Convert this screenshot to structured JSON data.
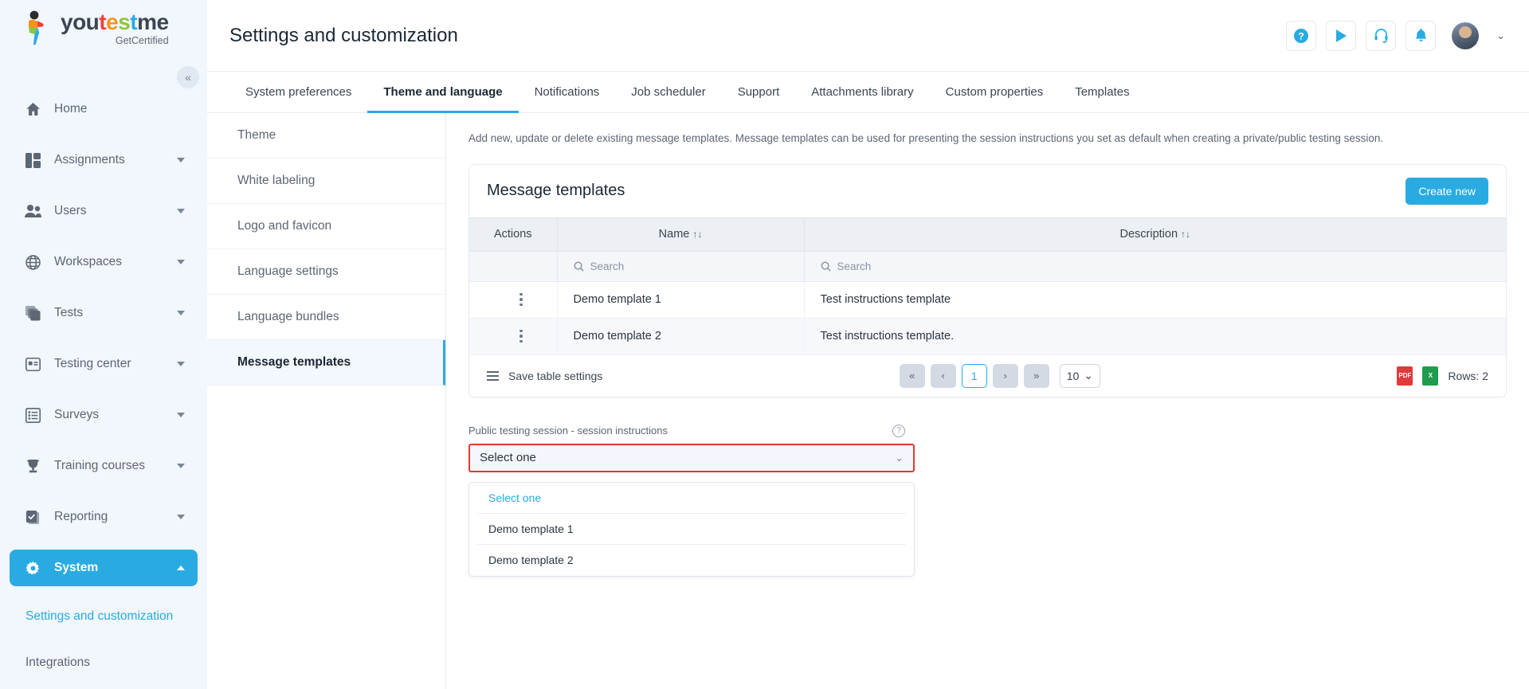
{
  "brand": {
    "name_parts": [
      "you",
      "t",
      "e",
      "s",
      "t",
      "me"
    ],
    "tagline": "GetCertified",
    "collapse_icon": "«"
  },
  "sidebar": {
    "items": [
      {
        "label": "Home",
        "icon": "home-icon",
        "has_caret": false,
        "active": false
      },
      {
        "label": "Assignments",
        "icon": "assignments-icon",
        "has_caret": true,
        "active": false
      },
      {
        "label": "Users",
        "icon": "users-icon",
        "has_caret": true,
        "active": false
      },
      {
        "label": "Workspaces",
        "icon": "globe-icon",
        "has_caret": true,
        "active": false
      },
      {
        "label": "Tests",
        "icon": "tests-icon",
        "has_caret": true,
        "active": false
      },
      {
        "label": "Testing center",
        "icon": "testing-center-icon",
        "has_caret": true,
        "active": false
      },
      {
        "label": "Surveys",
        "icon": "surveys-icon",
        "has_caret": true,
        "active": false
      },
      {
        "label": "Training courses",
        "icon": "trophy-icon",
        "has_caret": true,
        "active": false
      },
      {
        "label": "Reporting",
        "icon": "reporting-icon",
        "has_caret": true,
        "active": false
      },
      {
        "label": "System",
        "icon": "gear-icon",
        "has_caret": true,
        "active": true
      }
    ],
    "sub_items": [
      {
        "label": "Settings and customization",
        "linked": true
      },
      {
        "label": "Integrations",
        "linked": false
      }
    ]
  },
  "header": {
    "title": "Settings and customization",
    "actions": [
      {
        "name": "help-icon",
        "glyph": "?"
      },
      {
        "name": "play-icon",
        "glyph": "▶"
      },
      {
        "name": "headset-support-icon",
        "glyph": "headset"
      },
      {
        "name": "bell-notifications-icon",
        "glyph": "bell"
      }
    ],
    "avatar_caret": "⌄"
  },
  "tabs": [
    {
      "label": "System preferences",
      "active": false
    },
    {
      "label": "Theme and language",
      "active": true
    },
    {
      "label": "Notifications",
      "active": false
    },
    {
      "label": "Job scheduler",
      "active": false
    },
    {
      "label": "Support",
      "active": false
    },
    {
      "label": "Attachments library",
      "active": false
    },
    {
      "label": "Custom properties",
      "active": false
    },
    {
      "label": "Templates",
      "active": false
    }
  ],
  "subnav": [
    {
      "label": "Theme",
      "active": false
    },
    {
      "label": "White labeling",
      "active": false
    },
    {
      "label": "Logo and favicon",
      "active": false
    },
    {
      "label": "Language settings",
      "active": false
    },
    {
      "label": "Language bundles",
      "active": false
    },
    {
      "label": "Message templates",
      "active": true
    }
  ],
  "content": {
    "hint": "Add new, update or delete existing message templates. Message templates can be used for presenting the session instructions you set as default when creating a private/public testing session.",
    "card": {
      "title": "Message templates",
      "create_button": "Create new"
    },
    "table": {
      "columns": [
        {
          "label": "Actions",
          "sortable": false
        },
        {
          "label": "Name",
          "sortable": true,
          "sort_indicator": "↑↓"
        },
        {
          "label": "Description",
          "sortable": true,
          "sort_indicator": "↑↓"
        }
      ],
      "search_placeholder": "Search",
      "rows": [
        {
          "name": "Demo template 1",
          "description": "Test instructions template"
        },
        {
          "name": "Demo template 2",
          "description": "Test instructions template."
        }
      ],
      "footer": {
        "save_settings": "Save table settings",
        "first_page": "«",
        "prev_page": "‹",
        "current_page": "1",
        "next_page": "›",
        "last_page": "»",
        "page_size": "10",
        "page_size_caret": "⌄",
        "export_pdf_label": "PDF",
        "export_excel_label": "X",
        "rows_count": "Rows: 2"
      }
    },
    "select": {
      "label": "Public testing session - session instructions",
      "help_glyph": "?",
      "value": "Select one",
      "caret": "⌄",
      "options": [
        {
          "label": "Select one",
          "placeholder": true
        },
        {
          "label": "Demo template 1",
          "placeholder": false
        },
        {
          "label": "Demo template 2",
          "placeholder": false
        }
      ]
    }
  },
  "colors": {
    "accent": "#29abe2",
    "error_border": "#e03a2f",
    "sidebar_bg": "#f2f6fd"
  }
}
